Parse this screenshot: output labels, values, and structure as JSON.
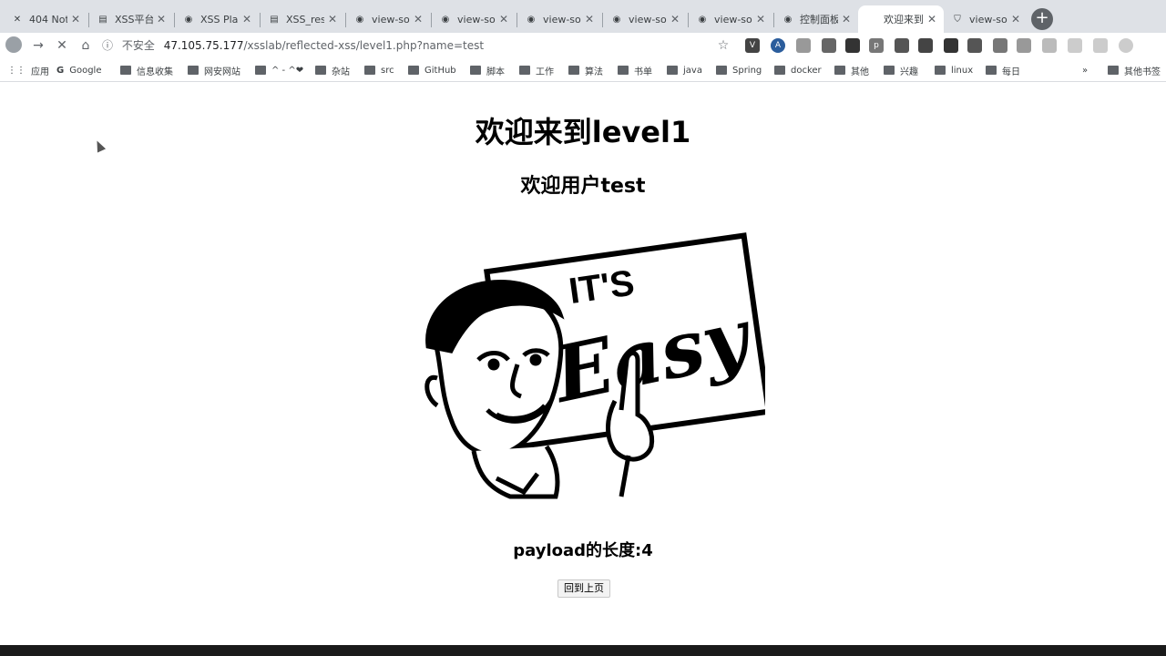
{
  "tabs": [
    {
      "title": "404 Not",
      "icon": "x-icon"
    },
    {
      "title": "XSS平台",
      "icon": "page-icon"
    },
    {
      "title": "XSS Pla",
      "icon": "globe-icon"
    },
    {
      "title": "XSS_res",
      "icon": "page-icon"
    },
    {
      "title": "view-so",
      "icon": "globe-icon"
    },
    {
      "title": "view-so",
      "icon": "globe-icon"
    },
    {
      "title": "view-so",
      "icon": "globe-icon"
    },
    {
      "title": "view-so",
      "icon": "globe-icon"
    },
    {
      "title": "view-so",
      "icon": "globe-icon"
    },
    {
      "title": "控制面板",
      "icon": "globe-icon"
    },
    {
      "title": "欢迎来到",
      "icon": "page-icon"
    },
    {
      "title": "view-so",
      "icon": "shield-icon"
    }
  ],
  "new_tab_label": "+",
  "address": {
    "warning": "不安全",
    "host": "47.105.75.177",
    "path": "/xsslab/reflected-xss/level1.php?name=test"
  },
  "bookmarks": [
    {
      "label": "应用"
    },
    {
      "label": "Google"
    },
    {
      "label": "信息收集"
    },
    {
      "label": "网安网站"
    },
    {
      "label": "^ - ^❤"
    },
    {
      "label": "杂站"
    },
    {
      "label": "src"
    },
    {
      "label": "GitHub"
    },
    {
      "label": "脚本"
    },
    {
      "label": "工作"
    },
    {
      "label": "算法"
    },
    {
      "label": "书单"
    },
    {
      "label": "java"
    },
    {
      "label": "Spring"
    },
    {
      "label": "docker"
    },
    {
      "label": "其他"
    },
    {
      "label": "兴趣"
    },
    {
      "label": "linux"
    },
    {
      "label": "每日"
    },
    {
      "label": "»"
    },
    {
      "label": "其他书签"
    }
  ],
  "page": {
    "heading": "欢迎来到level1",
    "welcome": "欢迎用户test",
    "sign_line1": "IT'S",
    "sign_line2": "Easy",
    "payload_length": "payload的长度:4",
    "back_button": "回到上页"
  },
  "colors": {
    "tabbar": "#dee1e6",
    "text": "#000000"
  }
}
